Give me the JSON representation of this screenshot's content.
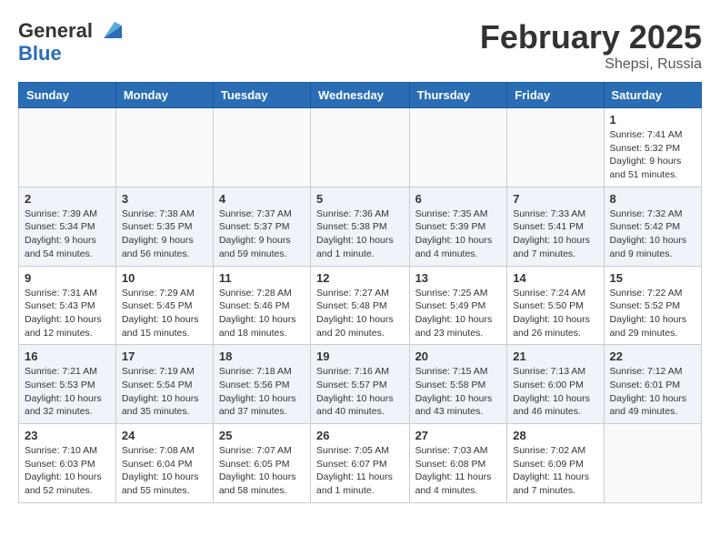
{
  "logo": {
    "general": "General",
    "blue": "Blue",
    "tagline": "GeneralBlue"
  },
  "header": {
    "month": "February 2025",
    "location": "Shepsi, Russia"
  },
  "days_of_week": [
    "Sunday",
    "Monday",
    "Tuesday",
    "Wednesday",
    "Thursday",
    "Friday",
    "Saturday"
  ],
  "weeks": [
    [
      {
        "day": "",
        "info": ""
      },
      {
        "day": "",
        "info": ""
      },
      {
        "day": "",
        "info": ""
      },
      {
        "day": "",
        "info": ""
      },
      {
        "day": "",
        "info": ""
      },
      {
        "day": "",
        "info": ""
      },
      {
        "day": "1",
        "info": "Sunrise: 7:41 AM\nSunset: 5:32 PM\nDaylight: 9 hours and 51 minutes."
      }
    ],
    [
      {
        "day": "2",
        "info": "Sunrise: 7:39 AM\nSunset: 5:34 PM\nDaylight: 9 hours and 54 minutes."
      },
      {
        "day": "3",
        "info": "Sunrise: 7:38 AM\nSunset: 5:35 PM\nDaylight: 9 hours and 56 minutes."
      },
      {
        "day": "4",
        "info": "Sunrise: 7:37 AM\nSunset: 5:37 PM\nDaylight: 9 hours and 59 minutes."
      },
      {
        "day": "5",
        "info": "Sunrise: 7:36 AM\nSunset: 5:38 PM\nDaylight: 10 hours and 1 minute."
      },
      {
        "day": "6",
        "info": "Sunrise: 7:35 AM\nSunset: 5:39 PM\nDaylight: 10 hours and 4 minutes."
      },
      {
        "day": "7",
        "info": "Sunrise: 7:33 AM\nSunset: 5:41 PM\nDaylight: 10 hours and 7 minutes."
      },
      {
        "day": "8",
        "info": "Sunrise: 7:32 AM\nSunset: 5:42 PM\nDaylight: 10 hours and 9 minutes."
      }
    ],
    [
      {
        "day": "9",
        "info": "Sunrise: 7:31 AM\nSunset: 5:43 PM\nDaylight: 10 hours and 12 minutes."
      },
      {
        "day": "10",
        "info": "Sunrise: 7:29 AM\nSunset: 5:45 PM\nDaylight: 10 hours and 15 minutes."
      },
      {
        "day": "11",
        "info": "Sunrise: 7:28 AM\nSunset: 5:46 PM\nDaylight: 10 hours and 18 minutes."
      },
      {
        "day": "12",
        "info": "Sunrise: 7:27 AM\nSunset: 5:48 PM\nDaylight: 10 hours and 20 minutes."
      },
      {
        "day": "13",
        "info": "Sunrise: 7:25 AM\nSunset: 5:49 PM\nDaylight: 10 hours and 23 minutes."
      },
      {
        "day": "14",
        "info": "Sunrise: 7:24 AM\nSunset: 5:50 PM\nDaylight: 10 hours and 26 minutes."
      },
      {
        "day": "15",
        "info": "Sunrise: 7:22 AM\nSunset: 5:52 PM\nDaylight: 10 hours and 29 minutes."
      }
    ],
    [
      {
        "day": "16",
        "info": "Sunrise: 7:21 AM\nSunset: 5:53 PM\nDaylight: 10 hours and 32 minutes."
      },
      {
        "day": "17",
        "info": "Sunrise: 7:19 AM\nSunset: 5:54 PM\nDaylight: 10 hours and 35 minutes."
      },
      {
        "day": "18",
        "info": "Sunrise: 7:18 AM\nSunset: 5:56 PM\nDaylight: 10 hours and 37 minutes."
      },
      {
        "day": "19",
        "info": "Sunrise: 7:16 AM\nSunset: 5:57 PM\nDaylight: 10 hours and 40 minutes."
      },
      {
        "day": "20",
        "info": "Sunrise: 7:15 AM\nSunset: 5:58 PM\nDaylight: 10 hours and 43 minutes."
      },
      {
        "day": "21",
        "info": "Sunrise: 7:13 AM\nSunset: 6:00 PM\nDaylight: 10 hours and 46 minutes."
      },
      {
        "day": "22",
        "info": "Sunrise: 7:12 AM\nSunset: 6:01 PM\nDaylight: 10 hours and 49 minutes."
      }
    ],
    [
      {
        "day": "23",
        "info": "Sunrise: 7:10 AM\nSunset: 6:03 PM\nDaylight: 10 hours and 52 minutes."
      },
      {
        "day": "24",
        "info": "Sunrise: 7:08 AM\nSunset: 6:04 PM\nDaylight: 10 hours and 55 minutes."
      },
      {
        "day": "25",
        "info": "Sunrise: 7:07 AM\nSunset: 6:05 PM\nDaylight: 10 hours and 58 minutes."
      },
      {
        "day": "26",
        "info": "Sunrise: 7:05 AM\nSunset: 6:07 PM\nDaylight: 11 hours and 1 minute."
      },
      {
        "day": "27",
        "info": "Sunrise: 7:03 AM\nSunset: 6:08 PM\nDaylight: 11 hours and 4 minutes."
      },
      {
        "day": "28",
        "info": "Sunrise: 7:02 AM\nSunset: 6:09 PM\nDaylight: 11 hours and 7 minutes."
      },
      {
        "day": "",
        "info": ""
      }
    ]
  ]
}
